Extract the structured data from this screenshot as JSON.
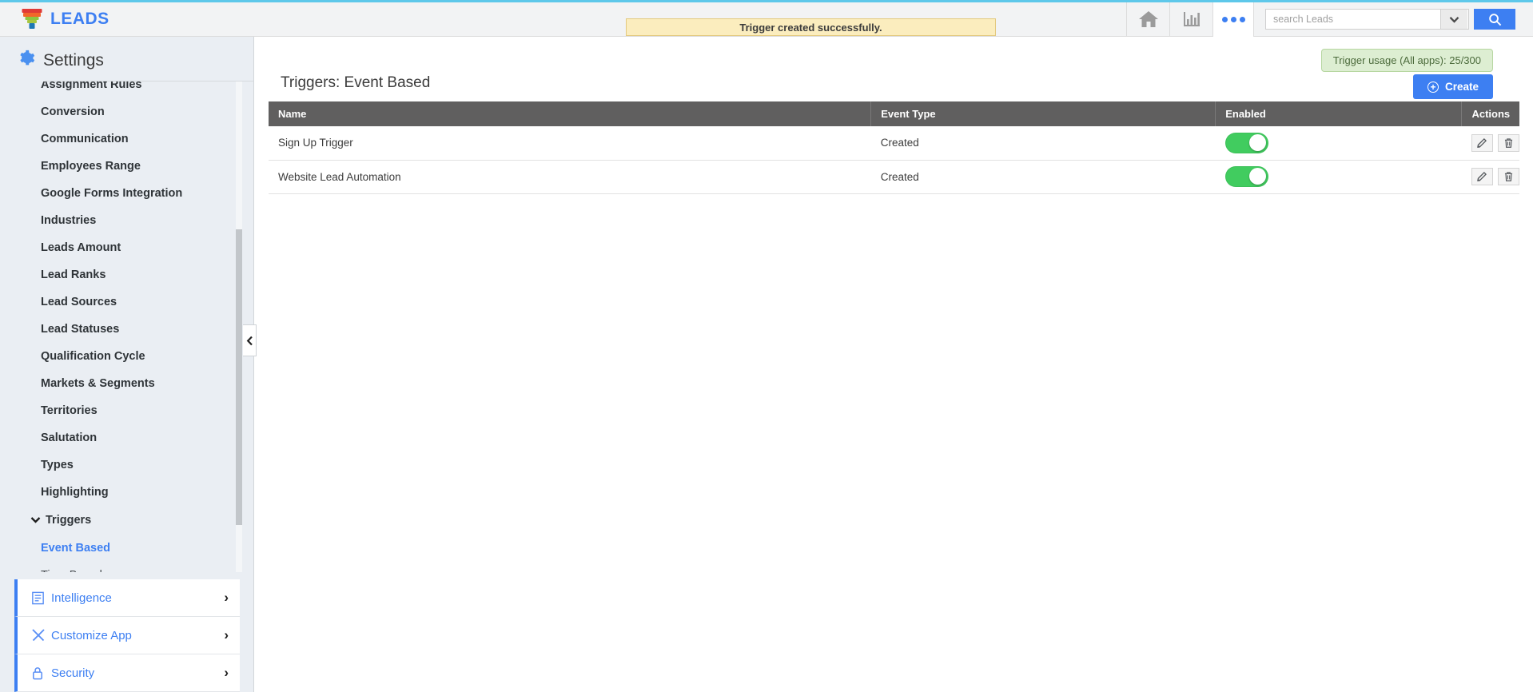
{
  "topbar": {
    "brand_name": "LEADS",
    "logo_icon": "funnel-icon",
    "home_icon": "home-icon",
    "reports_icon": "bar-chart-icon",
    "more_icon": "three-dots-icon",
    "search_placeholder": "search Leads",
    "search_value": "",
    "dropdown_icon": "chevron-down-icon",
    "search_icon": "search-icon"
  },
  "notification": {
    "message": "Trigger created successfully."
  },
  "sidebar": {
    "header": "Settings",
    "header_icon": "gear-icon",
    "items": [
      {
        "label": "Assignment Rules"
      },
      {
        "label": "Conversion"
      },
      {
        "label": "Communication"
      },
      {
        "label": "Employees Range"
      },
      {
        "label": "Google Forms Integration"
      },
      {
        "label": "Industries"
      },
      {
        "label": "Leads Amount"
      },
      {
        "label": "Lead Ranks"
      },
      {
        "label": "Lead Sources"
      },
      {
        "label": "Lead Statuses"
      },
      {
        "label": "Qualification Cycle"
      },
      {
        "label": "Markets & Segments"
      },
      {
        "label": "Territories"
      },
      {
        "label": "Salutation"
      },
      {
        "label": "Types"
      },
      {
        "label": "Highlighting"
      }
    ],
    "triggers_group": {
      "label": "Triggers",
      "expanded_icon": "chevron-down-icon",
      "children": [
        {
          "label": "Event Based",
          "active": true
        },
        {
          "label": "Time Based",
          "active": false
        }
      ]
    },
    "accordion": [
      {
        "label": "Intelligence",
        "icon": "document-lines-icon"
      },
      {
        "label": "Customize App",
        "icon": "tools-icon"
      },
      {
        "label": "Security",
        "icon": "lock-icon"
      }
    ],
    "collapse_icon": "chevron-left-icon"
  },
  "main": {
    "usage_badge": "Trigger usage (All apps): 25/300",
    "page_title": "Triggers: Event Based",
    "create_label": "Create",
    "create_icon": "plus-circle-icon",
    "table": {
      "columns": [
        "Name",
        "Event Type",
        "Enabled",
        "Actions"
      ],
      "rows": [
        {
          "name": "Sign Up Trigger",
          "event_type": "Created",
          "enabled": true
        },
        {
          "name": "Website Lead Automation",
          "event_type": "Created",
          "enabled": true
        }
      ],
      "edit_icon": "pencil-icon",
      "delete_icon": "trash-icon"
    }
  },
  "colors": {
    "accent_blue": "#3d7ff2",
    "toggle_green": "#41cc5f",
    "header_gray": "#605f5f",
    "notice_yellow": "#fbedbe",
    "badge_green": "#ddeed2"
  }
}
